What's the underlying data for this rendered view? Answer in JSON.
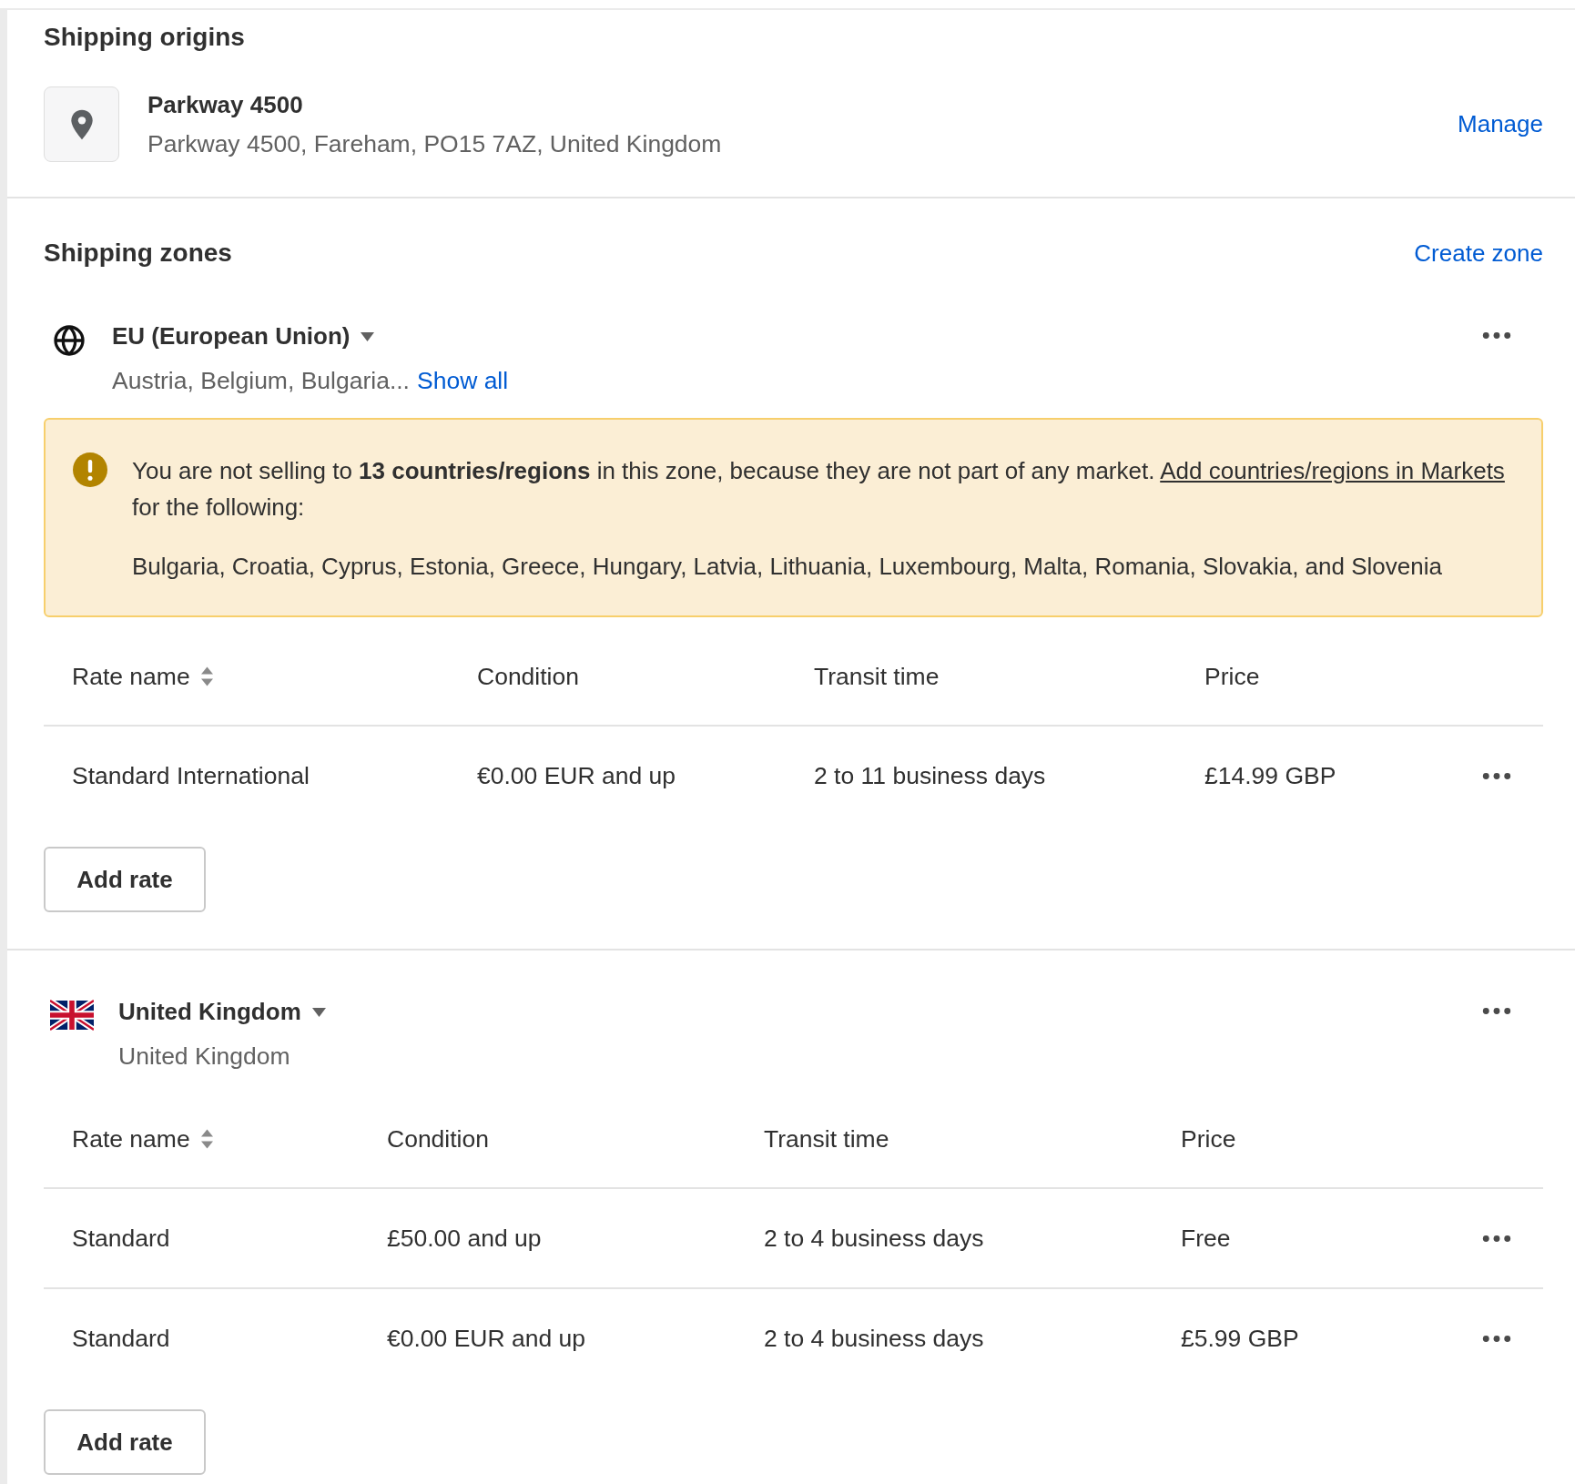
{
  "origins": {
    "title": "Shipping origins",
    "location": {
      "name": "Parkway 4500",
      "address": "Parkway 4500, Fareham, PO15 7AZ, United Kingdom"
    },
    "manage_link": "Manage"
  },
  "zones": {
    "title": "Shipping zones",
    "create_link": "Create zone",
    "items": [
      {
        "kind": "globe",
        "name": "EU (European Union)",
        "countries": "Austria, Belgium, Bulgaria...",
        "show_all_link": "Show all",
        "banner": {
          "before": "You are not selling to **13 countries/regions** in this zone, because they are not part of any market. ",
          "link": "Add countries/regions in Markets",
          "after": " for the following:",
          "list": "Bulgaria, Croatia, Cyprus, Estonia, Greece, Hungary, Latvia, Lithuania, Luxembourg, Malta, Romania, Slovakia, and Slovenia"
        },
        "columns": [
          {
            "label": "Rate name",
            "sortable": true
          },
          {
            "label": "Condition",
            "sortable": false
          },
          {
            "label": "Transit time",
            "sortable": false
          },
          {
            "label": "Price",
            "sortable": false
          }
        ],
        "rows": [
          [
            "Standard International",
            "€0.00 EUR and up",
            "2 to 11 business days",
            "£14.99 GBP"
          ]
        ],
        "add_rate": "Add rate"
      },
      {
        "kind": "flag",
        "name": "United Kingdom",
        "countries": "United Kingdom",
        "columns": [
          {
            "label": "Rate name",
            "sortable": true
          },
          {
            "label": "Condition",
            "sortable": false
          },
          {
            "label": "Transit time",
            "sortable": false
          },
          {
            "label": "Price",
            "sortable": false
          }
        ],
        "rows": [
          [
            "Standard",
            "£50.00 and up",
            "2 to 4 business days",
            "Free"
          ],
          [
            "Standard",
            "€0.00 EUR and up",
            "2 to 4 business days",
            "£5.99 GBP"
          ]
        ],
        "add_rate": "Add rate"
      }
    ]
  }
}
